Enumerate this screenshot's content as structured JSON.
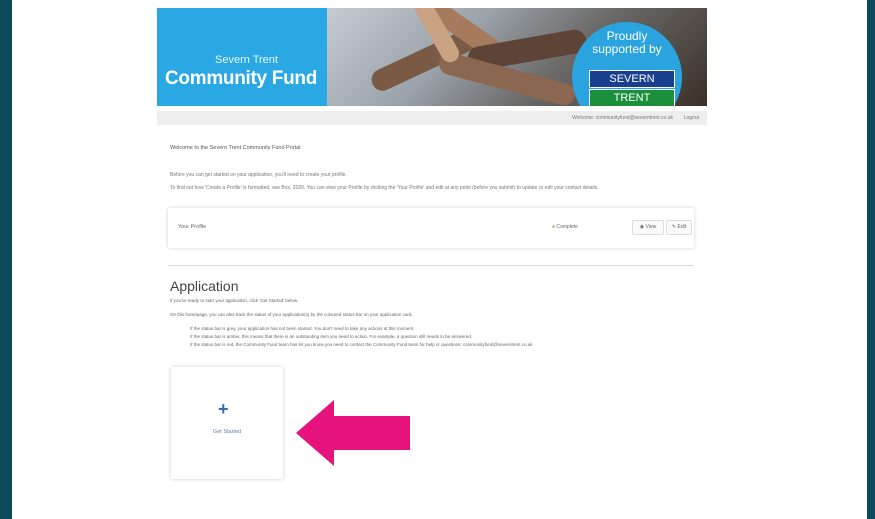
{
  "banner": {
    "subtitle": "Severn Trent",
    "title": "Community Fund",
    "supported_text": "Proudly supported by",
    "logo_top": "SEVERN",
    "logo_bottom": "TRENT"
  },
  "userbar": {
    "email": "Welcome: communityfund@severntrent.co.uk",
    "logout": "Logout"
  },
  "welcome": "Welcome to the Severn Trent Community Fund Portal",
  "intro": [
    "Before you can get started on your application, you'll need to create your profile.",
    "To find out how 'Create a Profile' is formatted, see Box. 2020. You can view your Profile by clicking the 'Your Profile' and edit at any point (before you submit) to update or edit your contact details."
  ],
  "profile_card": {
    "label": "Your Profile",
    "status": "Complete",
    "view_label": "View",
    "edit_label": "Edit"
  },
  "application": {
    "title": "Application",
    "line1": "If you've ready to start your application, click 'Get Started' below.",
    "line2": "On this homepage, you can also track the status of your application(s) by the coloured status bar on your application card.",
    "bullets": [
      "If the status bar is grey, your application has not been started. You don't need to take any actions at this moment.",
      "If the status bar is amber, this means that there is an outstanding item you need to action. For example, a question still needs to be answered.",
      "If the status bar is red, the Community Fund team has let you know you need to contact the Community Fund team for help or questions: communityfund@severntrent.co.uk"
    ]
  },
  "new_application": {
    "label": "Get Started"
  },
  "colors": {
    "brand_blue": "#29a8e3",
    "arrow": "#e5137b",
    "severn_blue": "#1b3f8f",
    "trent_green": "#1b8f3a"
  }
}
